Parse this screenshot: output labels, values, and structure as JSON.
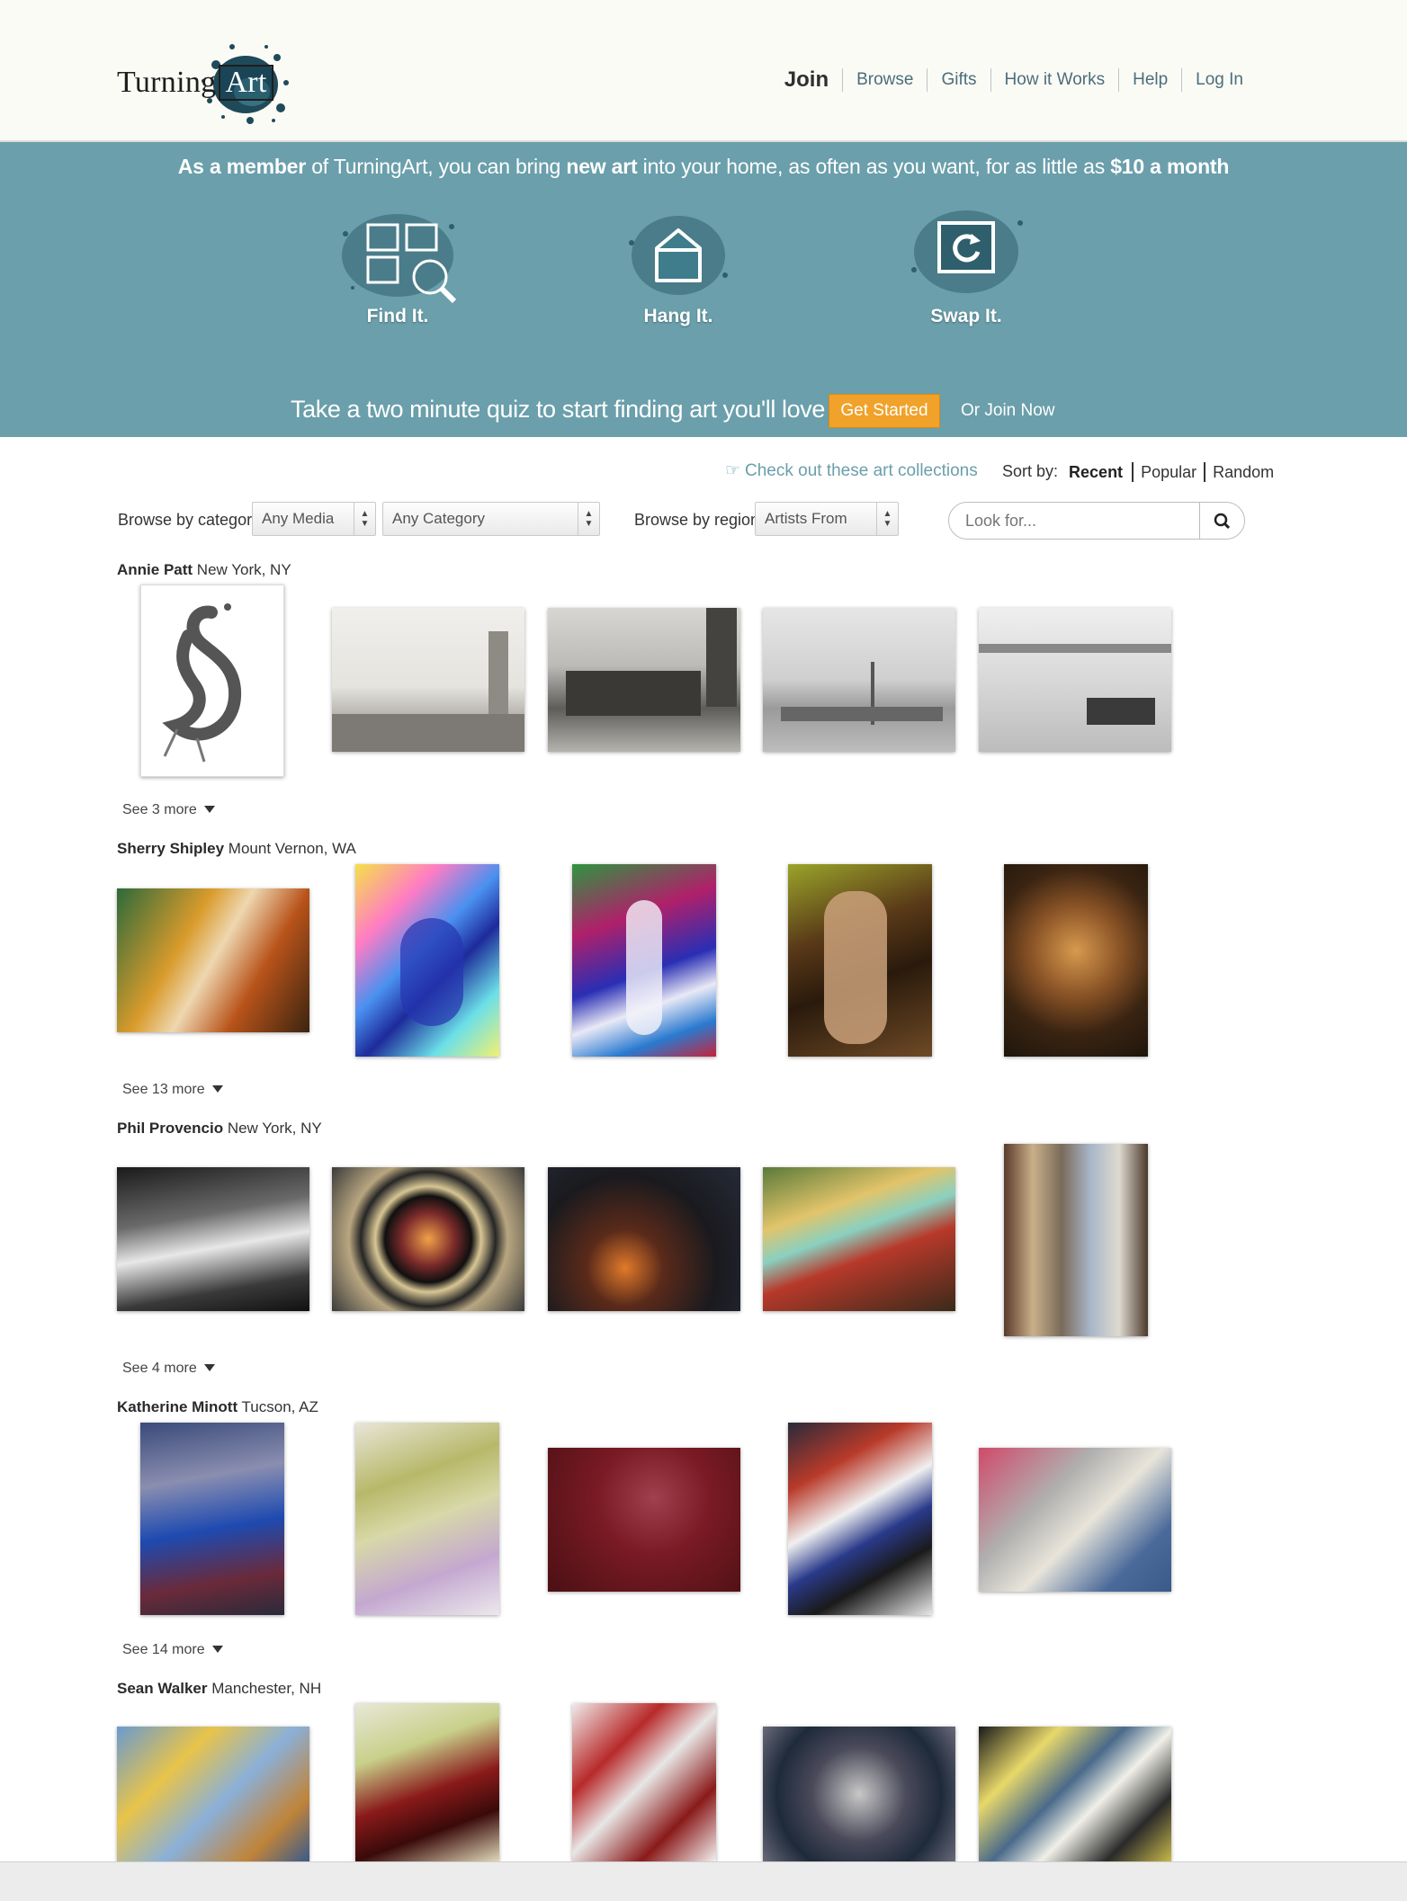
{
  "header": {
    "logo_text": "Turning",
    "logo_box_text": "Art",
    "nav": [
      "Join",
      "Browse",
      "Gifts",
      "How it Works",
      "Help",
      "Log In"
    ]
  },
  "banner": {
    "headline_parts": [
      "As a member",
      " of TurningArt, you can bring ",
      "new art",
      " into your home, as often as you want, for as little as ",
      "$10 a month"
    ],
    "steps": [
      {
        "label": "Find It.",
        "icon": "grid-search-icon"
      },
      {
        "label": "Hang It.",
        "icon": "house-icon"
      },
      {
        "label": "Swap It.",
        "icon": "refresh-icon"
      }
    ],
    "quiz_text": "Take a two minute quiz to start finding art you'll love",
    "get_started": "Get Started",
    "join_now": "Or Join Now"
  },
  "toolbar": {
    "collections_link": "Check out these art collections",
    "sort_label": "Sort by:",
    "sort_options": [
      "Recent",
      "Popular",
      "Random"
    ],
    "sort_active": "Recent",
    "browse_category_label": "Browse by category",
    "media_select": "Any Media",
    "category_select": "Any Category",
    "browse_region_label": "Browse by region",
    "region_select": "Artists From",
    "search_placeholder": "Look for..."
  },
  "artists": [
    {
      "name": "Annie Patt",
      "location": "New York, NY",
      "see_more": "See 3 more"
    },
    {
      "name": "Sherry Shipley",
      "location": "Mount Vernon, WA",
      "see_more": "See 13 more"
    },
    {
      "name": "Phil Provencio",
      "location": "New York, NY",
      "see_more": "See 4 more"
    },
    {
      "name": "Katherine Minott",
      "location": "Tucson, AZ",
      "see_more": "See 14 more"
    },
    {
      "name": "Sean Walker",
      "location": "Manchester, NH",
      "see_more": ""
    }
  ],
  "colors": {
    "banner": "#6a9fab",
    "accent": "#f0a22a",
    "link": "#6a9fab"
  }
}
